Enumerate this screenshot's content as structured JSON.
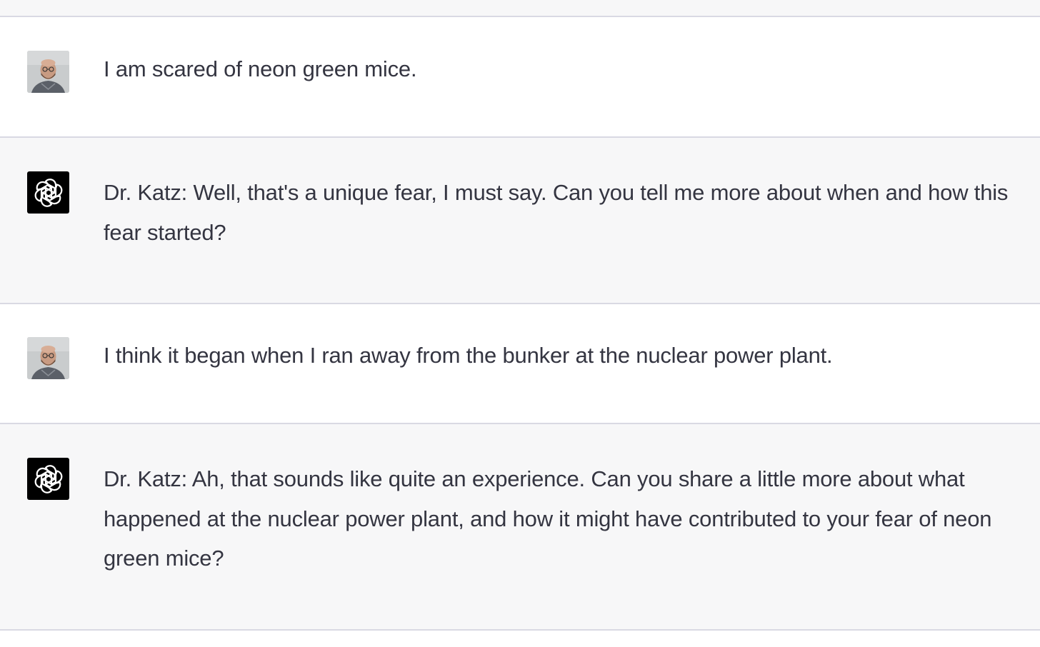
{
  "messages": [
    {
      "role": "user",
      "avatar_icon": "user-photo-avatar",
      "text": "I am scared of neon green mice."
    },
    {
      "role": "assistant",
      "avatar_icon": "openai-logo-icon",
      "text": "Dr. Katz: Well, that's a unique fear, I must say. Can you tell me more about when and how this fear started?"
    },
    {
      "role": "user",
      "avatar_icon": "user-photo-avatar",
      "text": "I think it began when I ran away from the bunker at the nuclear power plant."
    },
    {
      "role": "assistant",
      "avatar_icon": "openai-logo-icon",
      "text": "Dr. Katz: Ah, that sounds like quite an experience. Can you share a little more about what happened at the nuclear power plant, and how it might have contributed to your fear of neon green mice?"
    }
  ],
  "colors": {
    "user_bg": "#ffffff",
    "assistant_bg": "#f7f7f8",
    "divider": "#d9d9e3",
    "text": "#343541",
    "bot_avatar_bg": "#000000"
  }
}
